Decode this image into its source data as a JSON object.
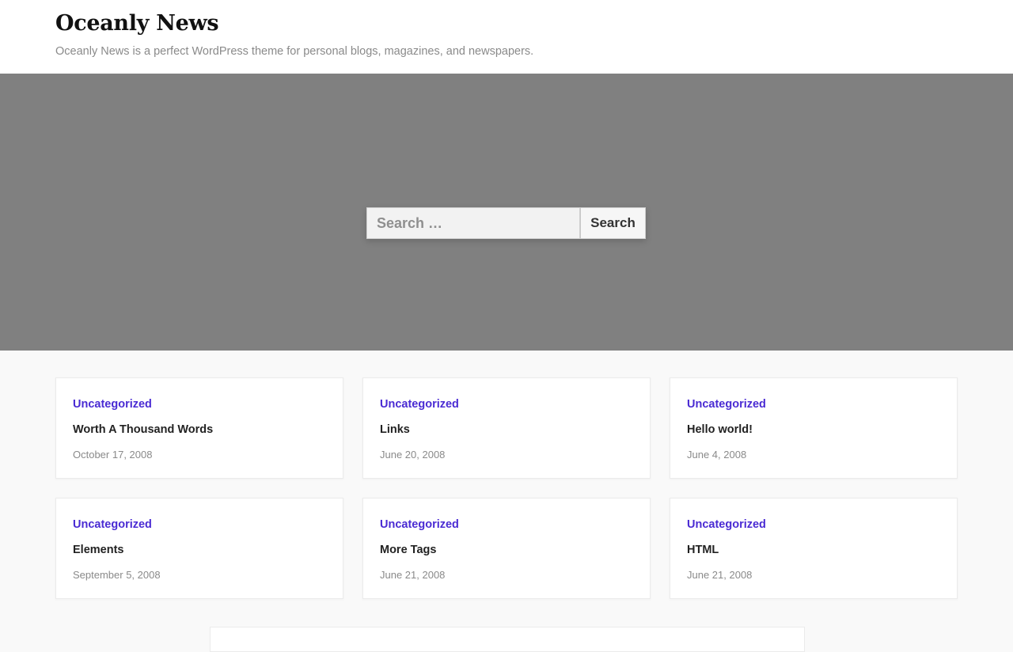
{
  "site": {
    "title": "Oceanly News",
    "description": "Oceanly News is a perfect WordPress theme for personal blogs, magazines, and newspapers."
  },
  "search": {
    "placeholder": "Search …",
    "button_label": "Search"
  },
  "colors": {
    "accent": "#4a2bd3",
    "hero_bg": "#808080",
    "page_bg": "#f9f9f9"
  },
  "posts": [
    {
      "category": "Uncategorized",
      "title": "Worth A Thousand Words",
      "date": "October 17, 2008"
    },
    {
      "category": "Uncategorized",
      "title": "Links",
      "date": "June 20, 2008"
    },
    {
      "category": "Uncategorized",
      "title": "Hello world!",
      "date": "June 4, 2008"
    },
    {
      "category": "Uncategorized",
      "title": "Elements",
      "date": "September 5, 2008"
    },
    {
      "category": "Uncategorized",
      "title": "More Tags",
      "date": "June 21, 2008"
    },
    {
      "category": "Uncategorized",
      "title": "HTML",
      "date": "June 21, 2008"
    }
  ]
}
